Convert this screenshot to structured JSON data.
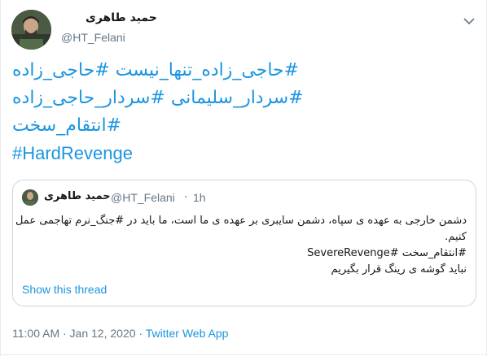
{
  "author": {
    "name": "حمید طاهری",
    "handle": "@HT_Felani"
  },
  "tweet": {
    "hashtag_lines": [
      "#حاجی_زاده_تنها_نیست #حاجی_زاده",
      "#سردار_سلیمانی #سردار_حاجی_زاده",
      "#انتقام_سخت",
      "#HardRevenge"
    ]
  },
  "quoted_tweet": {
    "name": "حمید طاهری",
    "handle": "@HT_Felani",
    "separator": "·",
    "time": "1h",
    "text_lines": [
      "دشمن خارجی به عهده ی سپاه، دشمن سایبری بر عهده ی ما است، ما باید در #جنگ_نرم تهاجمی عمل",
      "کنیم.",
      "#انتقام_سخت #SevereRevenge",
      "نباید گوشه ی رینگ قرار بگیریم"
    ],
    "show_thread": "Show this thread"
  },
  "meta": {
    "timestamp": "11:00 AM · Jan 12, 2020 ·",
    "source": "Twitter Web App"
  },
  "icons": {
    "more": "chevron-down-icon",
    "avatar": "avatar-photo"
  },
  "colors": {
    "link": "#1b95e0",
    "secondary_text": "#657786",
    "border": "#ccd6dd"
  }
}
